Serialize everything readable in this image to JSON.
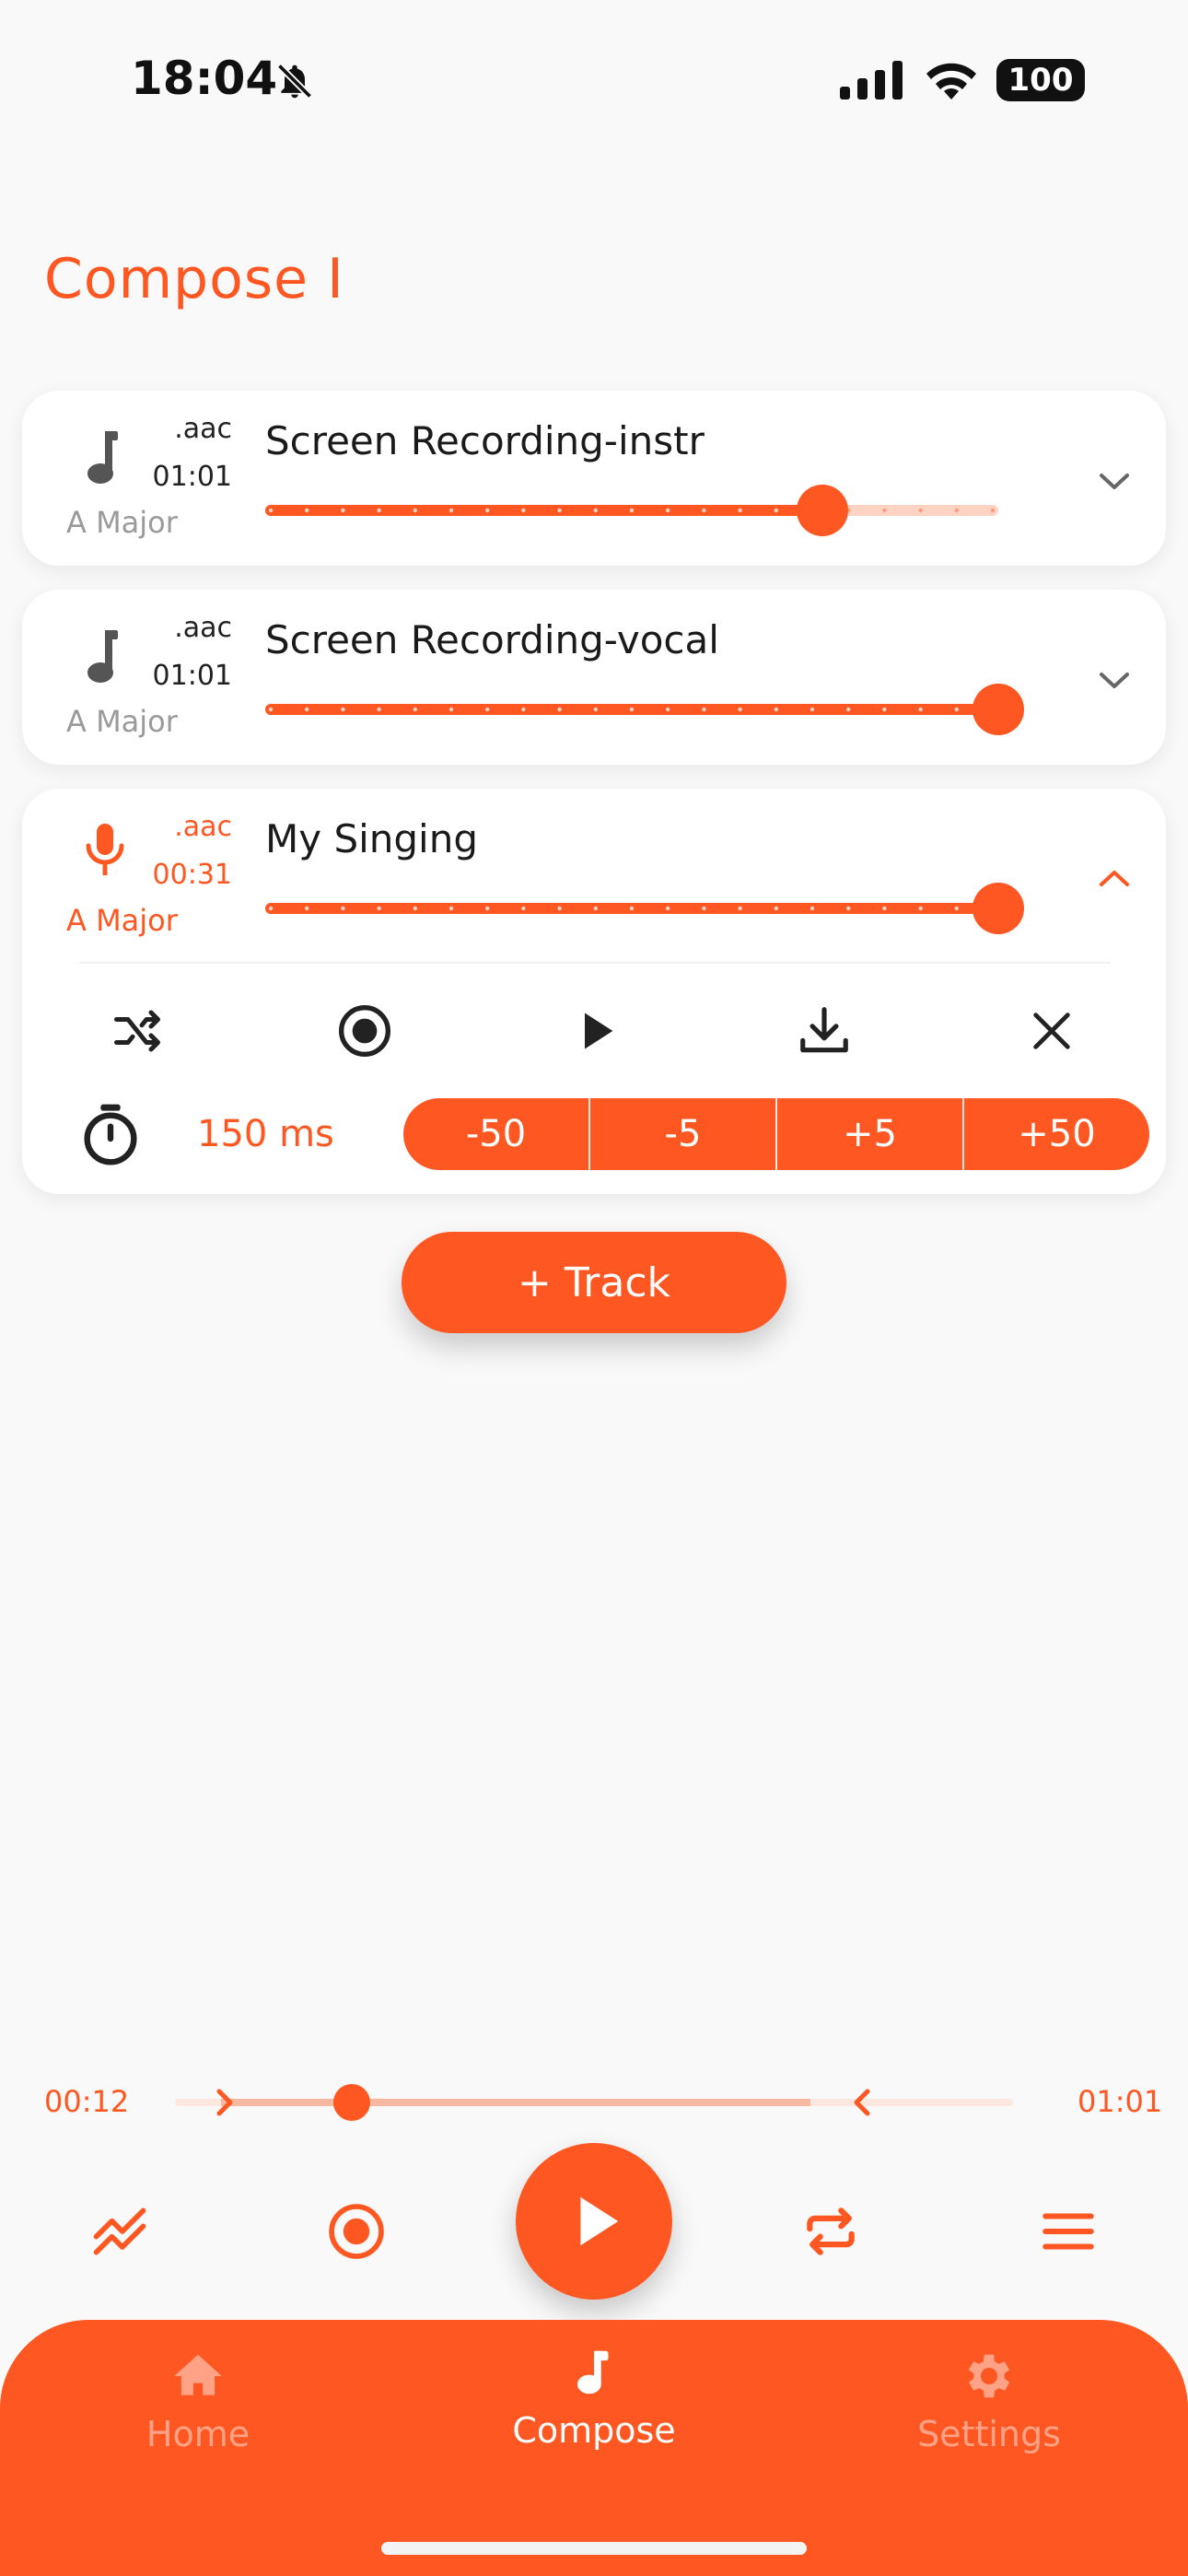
{
  "status_bar": {
    "time": "18:04",
    "battery": "100"
  },
  "page": {
    "title": "Compose I"
  },
  "tracks": [
    {
      "format": ".aac",
      "duration": "01:01",
      "key": "A Major",
      "name": "Screen Recording-instr",
      "volume": 0.76,
      "expanded": false
    },
    {
      "format": ".aac",
      "duration": "01:01",
      "key": "A Major",
      "name": "Screen Recording-vocal",
      "volume": 1.0,
      "expanded": false
    },
    {
      "format": ".aac",
      "duration": "00:31",
      "key": "A Major",
      "name": "My Singing",
      "volume": 1.0,
      "expanded": true
    }
  ],
  "expanded_controls": {
    "offset_value": "150 ms",
    "adjust_buttons": [
      "-50",
      "-5",
      "+5",
      "+50"
    ]
  },
  "add_track_label": "+ Track",
  "player": {
    "current_time": "00:12",
    "total_time": "01:01",
    "position": 0.197
  },
  "nav": {
    "home": "Home",
    "compose": "Compose",
    "settings": "Settings",
    "active": "compose"
  },
  "colors": {
    "accent": "#ff5722",
    "accent_light": "#ffd3c4",
    "background": "#f9f9f9"
  }
}
